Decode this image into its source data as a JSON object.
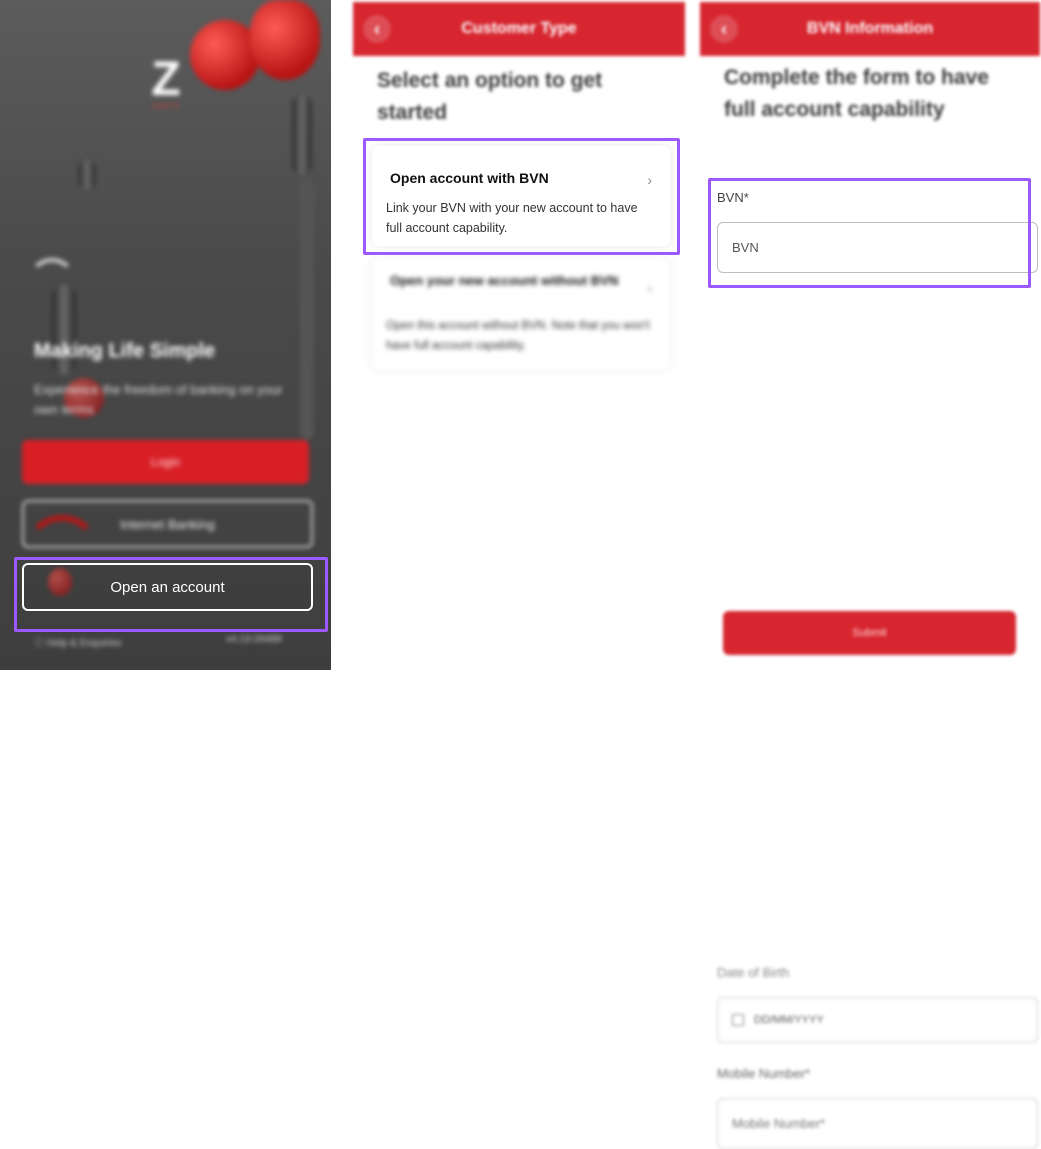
{
  "panel1": {
    "logo_letter": "Z",
    "logo_sub": "ZENITH",
    "title": "Making Life Simple",
    "subtitle": "Experience the freedom of banking on your own terms",
    "login_label": "Login",
    "internet_banking_label": "Internet Banking",
    "open_account_label": "Open an account",
    "help_label": "Help & Enquiries",
    "version": "v4.13-26488"
  },
  "panel2": {
    "header_title": "Customer Type",
    "heading": "Select an option to get started",
    "option1_title": "Open account with BVN",
    "option1_desc": "Link your BVN with your new account to have full account capability.",
    "option2_title": "Open your new account without BVN",
    "option2_desc": "Open this account without BVN. Note that you won't have full account capability."
  },
  "panel3": {
    "header_title": "BVN Information",
    "heading": "Complete the form to have full account capability",
    "bvn_label": "BVN*",
    "bvn_placeholder": "BVN",
    "dob_label": "Date of Birth",
    "dob_placeholder": "DD/MM/YYYY",
    "mobile_label": "Mobile Number*",
    "mobile_placeholder": "Mobile Number*",
    "submit_label": "Submit"
  },
  "colors": {
    "brand_red": "#d72630",
    "highlight_purple": "#9b59ff"
  },
  "icons": {
    "back": "back-chevron-icon",
    "chevron": "chevron-right-icon",
    "calendar": "calendar-icon",
    "help": "help-icon"
  }
}
